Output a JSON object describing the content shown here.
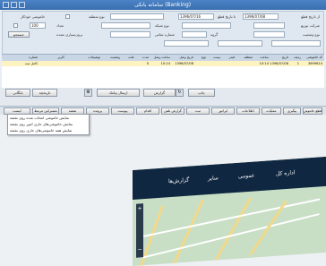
{
  "window": {
    "title": "سامانه بانکی (Banking)"
  },
  "filter": {
    "row1": {
      "from_date_label": "از تاریخ قطع",
      "from_date": "1396/07/08",
      "to_date_label": "تا تاریخ قطع",
      "to_date": "1396/07/16",
      "region_label": "نوع منطقه",
      "vahed_label": "واحد اجرایی",
      "khamooshi_label": "خاموشی خودکار"
    },
    "row2": {
      "district_label": "شرکت توزیع",
      "feeder_label": "نام فیدر",
      "post_label": "نوع شبکه",
      "count_label": "تعداد",
      "count_value": "100",
      "type_label": "نام"
    },
    "row3": {
      "status_label": "نوع وضعیت",
      "group_label": "گروه",
      "tel_label": "شماره تماس",
      "reason_label": "علت",
      "value_label": "برون‌سپاری نشده",
      "refresh": "جستجو"
    }
  },
  "table": {
    "headers": [
      "کد خاموشی",
      "ردیف",
      "تاریخ",
      "ساعت",
      "منطقه",
      "فیدر",
      "پست",
      "نوع",
      "تاریخ وصل",
      "ساعت وصل",
      "مدت",
      "علت",
      "وضعیت",
      "توضیحات",
      "کاربر",
      "شماره"
    ],
    "rows": [
      [
        "3699614",
        "1",
        "1396/07/08",
        "10:14",
        "",
        "",
        "",
        "",
        "1396/07/08",
        "10:14",
        "0",
        "",
        "",
        "",
        "",
        "کامل ثبت"
      ]
    ]
  },
  "toolbar": {
    "print": "چاپ",
    "send": "ارسال پیامک",
    "report": "گزارش",
    "archive": "بایگانی",
    "history": "تاریخچه",
    "save": "ذخیره"
  },
  "tabs": [
    "قطع خاموش",
    "پیگیری",
    "عملیات",
    "اطلاعات",
    "اپراتور",
    "ثبت",
    "گزارش تلفن",
    "اقدام",
    "پیوست",
    "پرونده",
    "نقشه",
    "مشترکین مرتبط",
    "لیست"
  ],
  "context_menu": {
    "items": [
      "نمایش خاموشی انتخاب شده روی نقشه",
      "نمایش خاموشی‌های جاری امور روی نقشه",
      "نمایش همه خاموشی‌های جاری روی نقشه"
    ]
  },
  "map": {
    "nav": [
      "اداره کل",
      "عمومی",
      "سایر",
      "گزارش‌ها"
    ]
  }
}
